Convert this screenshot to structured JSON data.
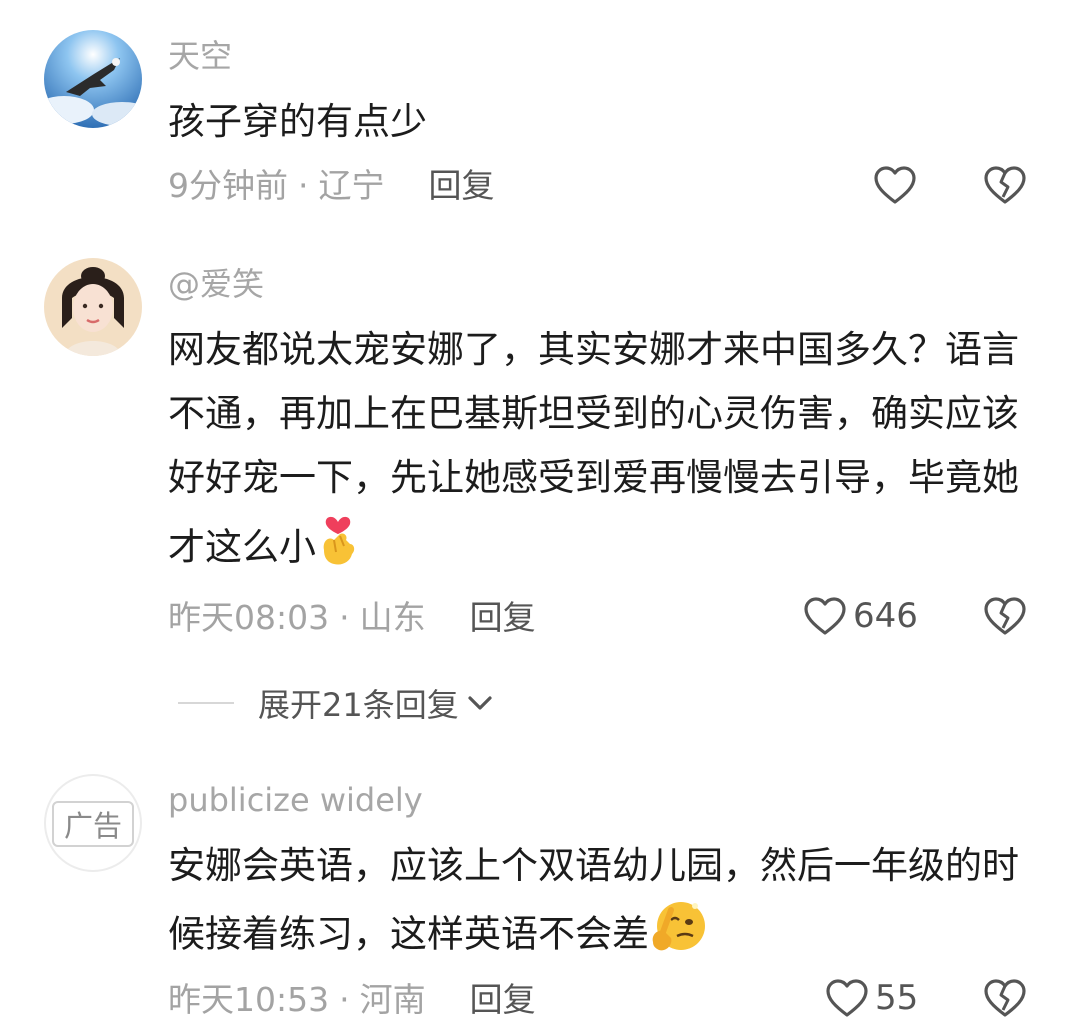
{
  "comments": [
    {
      "username": "天空",
      "text": "孩子穿的有点少",
      "time": "9分钟前",
      "location": "辽宁",
      "reply_label": "回复",
      "like_count": "",
      "avatar_icon": "eagle-sky-avatar"
    },
    {
      "username": "@爱笑",
      "text": "网友都说太宠安娜了，其实安娜才来中国多久？语言不通，再加上在巴基斯坦受到的心灵伤害，确实应该好好宠一下，先让她感受到爱再慢慢去引导，毕竟她才这么小",
      "time": "昨天08:03",
      "location": "山东",
      "reply_label": "回复",
      "like_count": "646",
      "expand_label": "展开21条回复",
      "avatar_icon": "woman-portrait-avatar"
    },
    {
      "username": "publicize widely",
      "ad_label": "广告",
      "text": "安娜会英语，应该上个双语幼儿园，然后一年级的时候接着练习，这样英语不会差",
      "time": "昨天10:53",
      "location": "河南",
      "reply_label": "回复",
      "like_count": "55",
      "avatar_icon": "ad-avatar"
    }
  ],
  "colors": {
    "meta": "#a3a3a3",
    "text": "#1c1c1c",
    "icon": "#555555"
  }
}
